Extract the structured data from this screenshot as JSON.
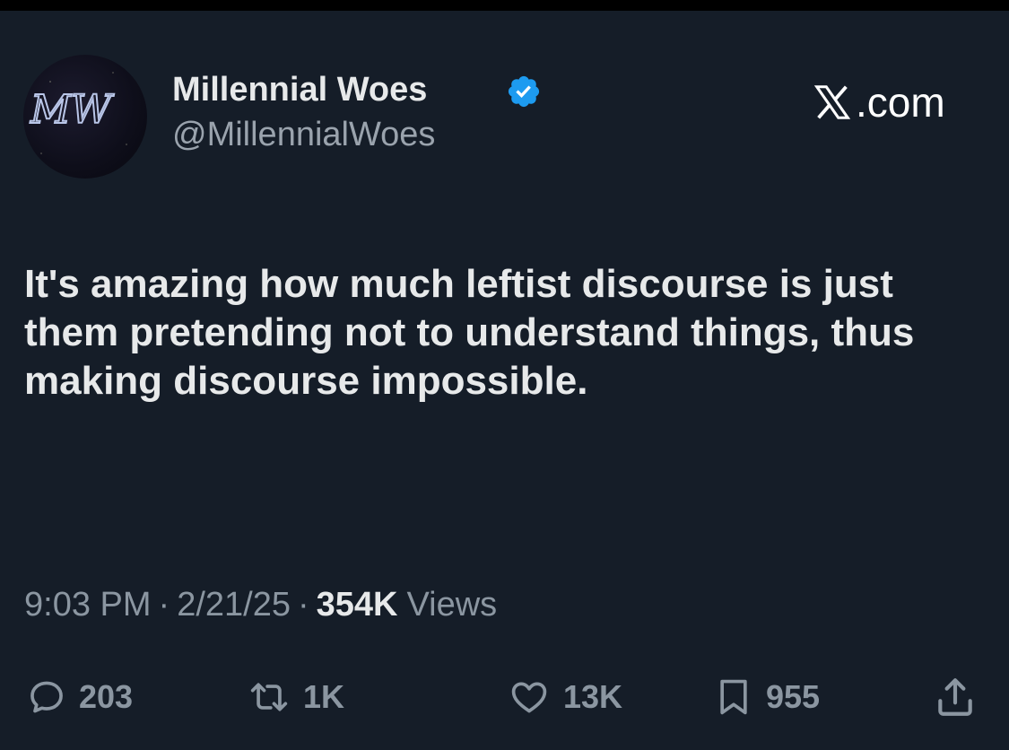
{
  "author": {
    "display_name": "Millennial Woes",
    "handle": "@MillennialWoes",
    "avatar_text": "MW",
    "verified": true,
    "verified_color": "#1d9bf0"
  },
  "brand": {
    "label": ".com",
    "icon": "x-logo-icon"
  },
  "tweet": {
    "text": "It's amazing how much leftist discourse is just them pretending not to understand things, thus making discourse impossible."
  },
  "meta": {
    "time": "9:03 PM",
    "separator": "·",
    "date": "2/21/25",
    "views_count": "354K",
    "views_label": "Views"
  },
  "actions": {
    "replies": {
      "icon": "reply-icon",
      "count": "203"
    },
    "reposts": {
      "icon": "repost-icon",
      "count": "1K"
    },
    "likes": {
      "icon": "heart-icon",
      "count": "13K"
    },
    "bookmarks": {
      "icon": "bookmark-icon",
      "count": "955"
    },
    "share": {
      "icon": "share-icon"
    }
  },
  "colors": {
    "background": "#151d28",
    "primary_text": "#e7e9ea",
    "secondary_text": "#8b96a1"
  }
}
